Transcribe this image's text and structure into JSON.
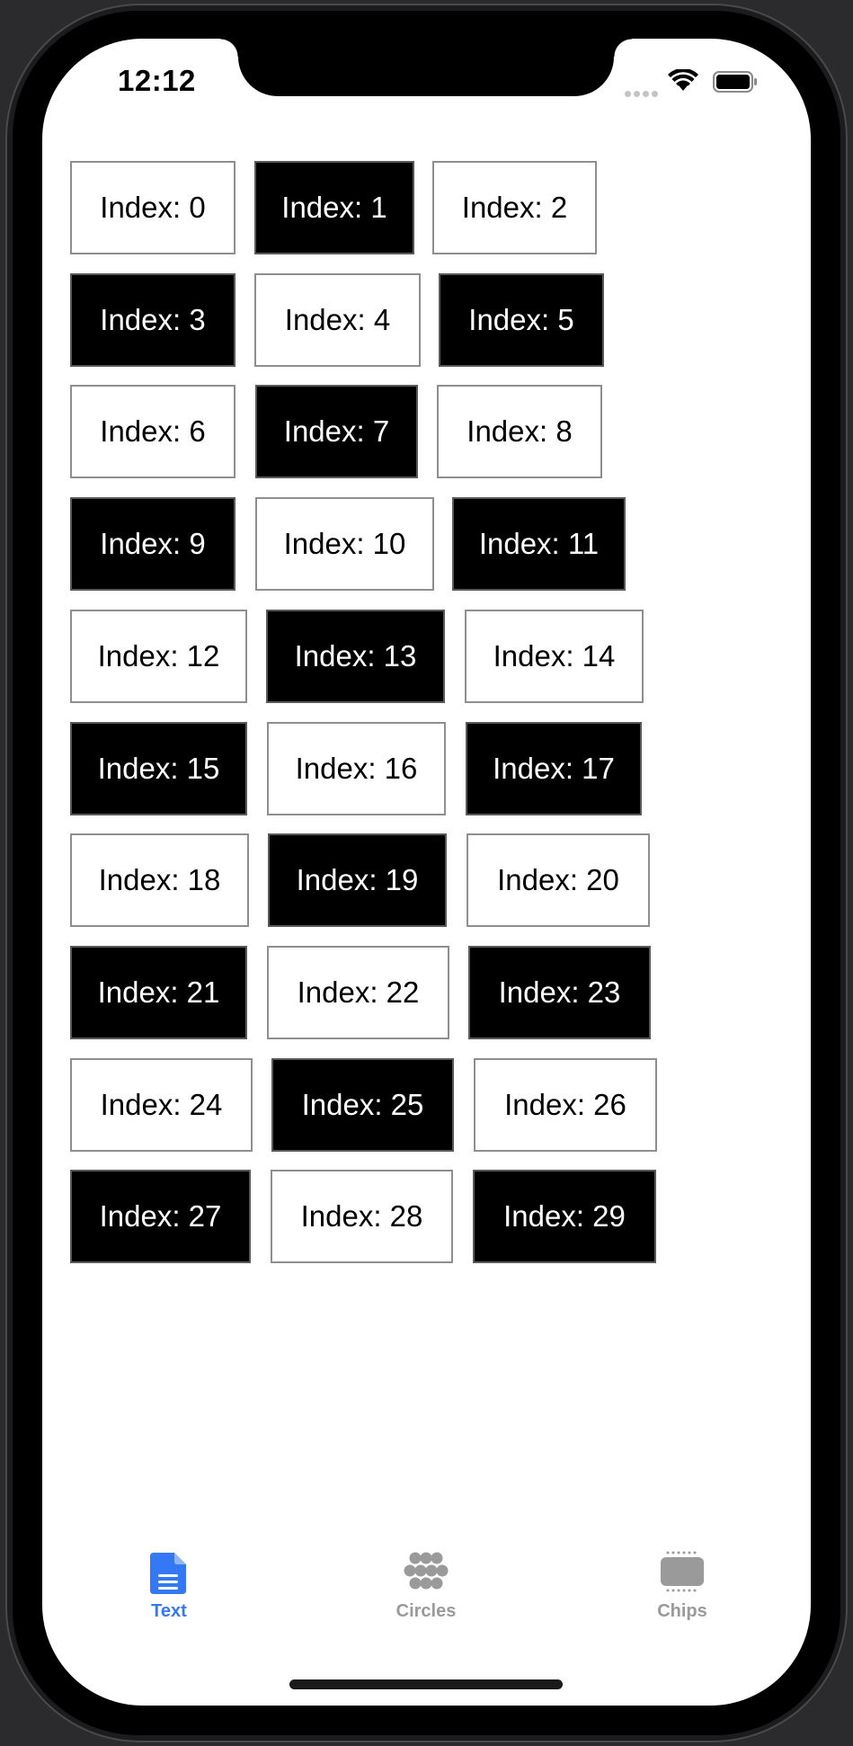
{
  "status_bar": {
    "time": "12:12"
  },
  "chips": [
    {
      "label": "Index: 0",
      "style": "light"
    },
    {
      "label": "Index: 1",
      "style": "dark"
    },
    {
      "label": "Index: 2",
      "style": "light"
    },
    {
      "label": "Index: 3",
      "style": "dark"
    },
    {
      "label": "Index: 4",
      "style": "light"
    },
    {
      "label": "Index: 5",
      "style": "dark"
    },
    {
      "label": "Index: 6",
      "style": "light"
    },
    {
      "label": "Index: 7",
      "style": "dark"
    },
    {
      "label": "Index: 8",
      "style": "light"
    },
    {
      "label": "Index: 9",
      "style": "dark"
    },
    {
      "label": "Index: 10",
      "style": "light"
    },
    {
      "label": "Index: 11",
      "style": "dark"
    },
    {
      "label": "Index: 12",
      "style": "light"
    },
    {
      "label": "Index: 13",
      "style": "dark"
    },
    {
      "label": "Index: 14",
      "style": "light"
    },
    {
      "label": "Index: 15",
      "style": "dark"
    },
    {
      "label": "Index: 16",
      "style": "light"
    },
    {
      "label": "Index: 17",
      "style": "dark"
    },
    {
      "label": "Index: 18",
      "style": "light"
    },
    {
      "label": "Index: 19",
      "style": "dark"
    },
    {
      "label": "Index: 20",
      "style": "light"
    },
    {
      "label": "Index: 21",
      "style": "dark"
    },
    {
      "label": "Index: 22",
      "style": "light"
    },
    {
      "label": "Index: 23",
      "style": "dark"
    },
    {
      "label": "Index: 24",
      "style": "light"
    },
    {
      "label": "Index: 25",
      "style": "dark"
    },
    {
      "label": "Index: 26",
      "style": "light"
    },
    {
      "label": "Index: 27",
      "style": "dark"
    },
    {
      "label": "Index: 28",
      "style": "light"
    },
    {
      "label": "Index: 29",
      "style": "dark"
    }
  ],
  "tab_bar": {
    "tabs": [
      {
        "label": "Text",
        "icon": "document-icon",
        "active": true
      },
      {
        "label": "Circles",
        "icon": "circles-icon",
        "active": false
      },
      {
        "label": "Chips",
        "icon": "chips-icon",
        "active": false
      }
    ]
  },
  "colors": {
    "accent": "#3478f6",
    "inactive_tab": "#9a9a9a",
    "chip_dark": "#000000",
    "chip_light": "#ffffff",
    "chip_border": "#8e8e8e"
  }
}
